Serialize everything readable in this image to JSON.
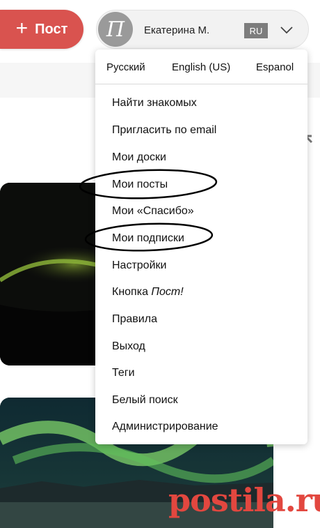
{
  "header": {
    "post_button_label": "Пост",
    "user_name": "Екатерина М.",
    "avatar_letter": "П",
    "language_badge": "RU"
  },
  "dropdown": {
    "languages": [
      "Русский",
      "English (US)",
      "Espanol"
    ],
    "items": [
      "Найти знакомых",
      "Пригласить по email",
      "Мои доски",
      "Мои посты",
      "Мои «Спасибо»",
      "Мои подписки",
      "Настройки",
      "Кнопка",
      "Правила",
      "Выход",
      "Теги",
      "Белый поиск",
      "Администрирование"
    ],
    "button_item_suffix": "Пост!"
  },
  "watermark": "postila.ru",
  "colors": {
    "post_button": "#d9534f",
    "language_badge": "#7d7d7d",
    "annotation_ellipse": "#000000"
  }
}
